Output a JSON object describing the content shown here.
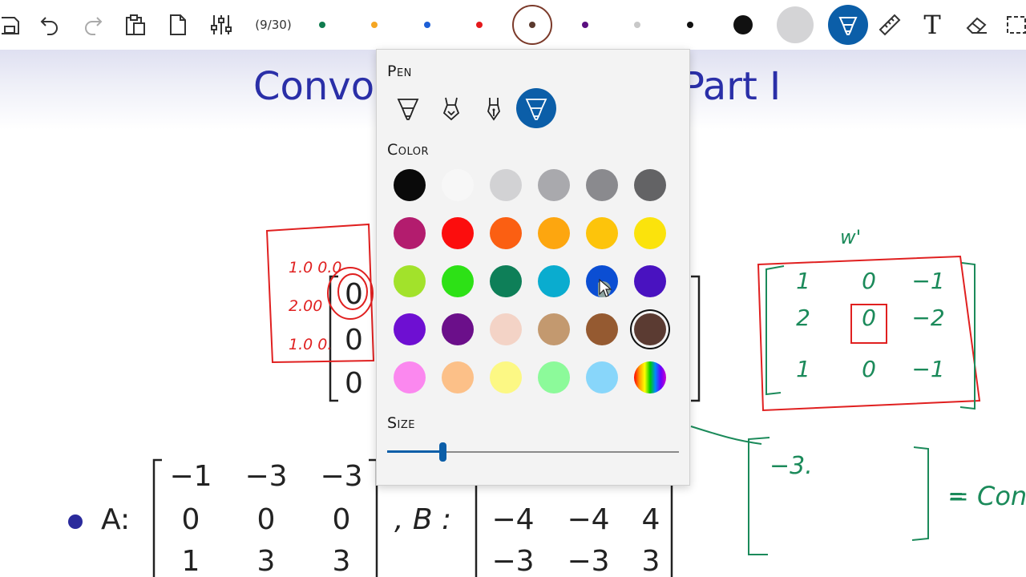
{
  "toolbar": {
    "page_counter": "(9/30)",
    "tools": [
      "save-icon",
      "undo-icon",
      "redo-icon",
      "paste-icon",
      "new-page-icon",
      "settings-sliders-icon",
      "highlighter-icon",
      "ruler-icon",
      "text-tool-icon",
      "eraser-icon",
      "select-icon"
    ],
    "quick_colors": [
      {
        "color": "#0f7b4e",
        "size": "small"
      },
      {
        "color": "#f5a623",
        "size": "small"
      },
      {
        "color": "#1d5fd6",
        "size": "small"
      },
      {
        "color": "#e4191c",
        "size": "small"
      },
      {
        "color": "#5b3a2e",
        "size": "small",
        "selected": true
      },
      {
        "color": "#5a1080",
        "size": "small"
      },
      {
        "color": "#c8c8c8",
        "size": "small"
      },
      {
        "color": "#111111",
        "size": "small"
      },
      {
        "color": "#111111",
        "size": "medium"
      },
      {
        "color": "#d4d4d6",
        "size": "large"
      }
    ]
  },
  "slide": {
    "title_left": "Convol",
    "title_right": "Part I",
    "bullet_label_a": "A:",
    "label_b": ", B :",
    "matrix_a": [
      [
        "−1",
        "−3",
        "−3"
      ],
      [
        "0",
        "0",
        "0"
      ],
      [
        "1",
        "3",
        "3"
      ]
    ],
    "matrix_b_visible": [
      [
        "−4",
        "−4",
        "4"
      ],
      [
        "−3",
        "−3",
        "3"
      ]
    ],
    "input_matrix_zeros": [
      "0",
      "0",
      "0"
    ],
    "annotation_w": "w'",
    "kernel": [
      [
        "1",
        "0",
        "−1"
      ],
      [
        "2",
        "0",
        "−2"
      ],
      [
        "1",
        "0",
        "−1"
      ]
    ],
    "result_entry": "−3.",
    "result_label": "= Con",
    "red_annotation_rows": [
      "1.0  0.0",
      "2.00",
      "1.0 0."
    ]
  },
  "panel": {
    "pen_title": "Pen",
    "color_title": "Color",
    "size_title": "Size",
    "pens": [
      "ballpoint-pen-icon",
      "pencil-icon",
      "fountain-pen-icon",
      "highlighter-icon"
    ],
    "active_pen_index": 3,
    "colors": [
      [
        "#0a0a0a",
        "#f7f7f7",
        "#d2d2d4",
        "#a9a9ad",
        "#8a8a8e",
        "#636365"
      ],
      [
        "#b31c6e",
        "#fc0d0d",
        "#fb5f12",
        "#fda60f",
        "#fdc40b",
        "#fbe30c"
      ],
      [
        "#a2e22b",
        "#2de116",
        "#0e7f58",
        "#0aaccf",
        "#0b4ed3",
        "#4912c0"
      ],
      [
        "#6e0fd2",
        "#6b0f8a",
        "#f3d3c6",
        "#c3996f",
        "#955a31",
        "#5b3b32"
      ],
      [
        "#fb88ef",
        "#fcc088",
        "#fcf884",
        "#8cfa9a",
        "#88d6fa",
        "rainbow"
      ]
    ],
    "selected_color": "#5b3b32",
    "size_value": 0.19
  }
}
